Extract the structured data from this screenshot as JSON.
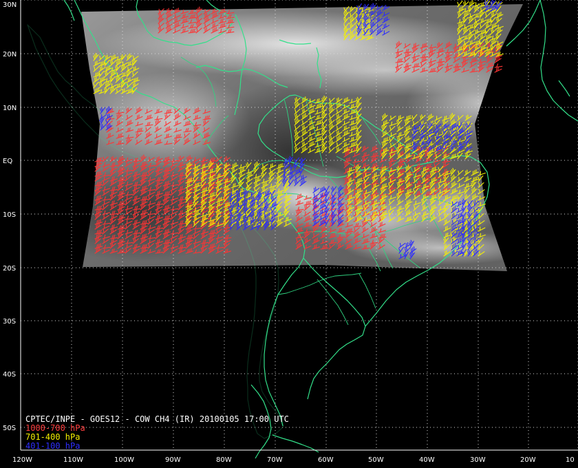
{
  "map": {
    "title": "CPTEC/INPE - GOES12 - COW CH4 (IR) 20100105 17:00 UTC",
    "latitude_labels": [
      "30N",
      "20N",
      "10N",
      "EQ",
      "10S",
      "20S",
      "30S",
      "40S",
      "50S"
    ],
    "longitude_labels": [
      "120W",
      "110W",
      "100W",
      "90W",
      "80W",
      "70W",
      "60W",
      "50W",
      "40W",
      "30W",
      "20W",
      "10"
    ],
    "legend": [
      {
        "label": "1000-700 hPa",
        "color": "#ff3d3d"
      },
      {
        "label": "701-400 hPa",
        "color": "#f4f000"
      },
      {
        "label": "401-100 hPa",
        "color": "#2e2eff"
      }
    ],
    "colors": {
      "background": "#000000",
      "coastline": "#33e08a",
      "grid": "#d8d8d8"
    }
  }
}
